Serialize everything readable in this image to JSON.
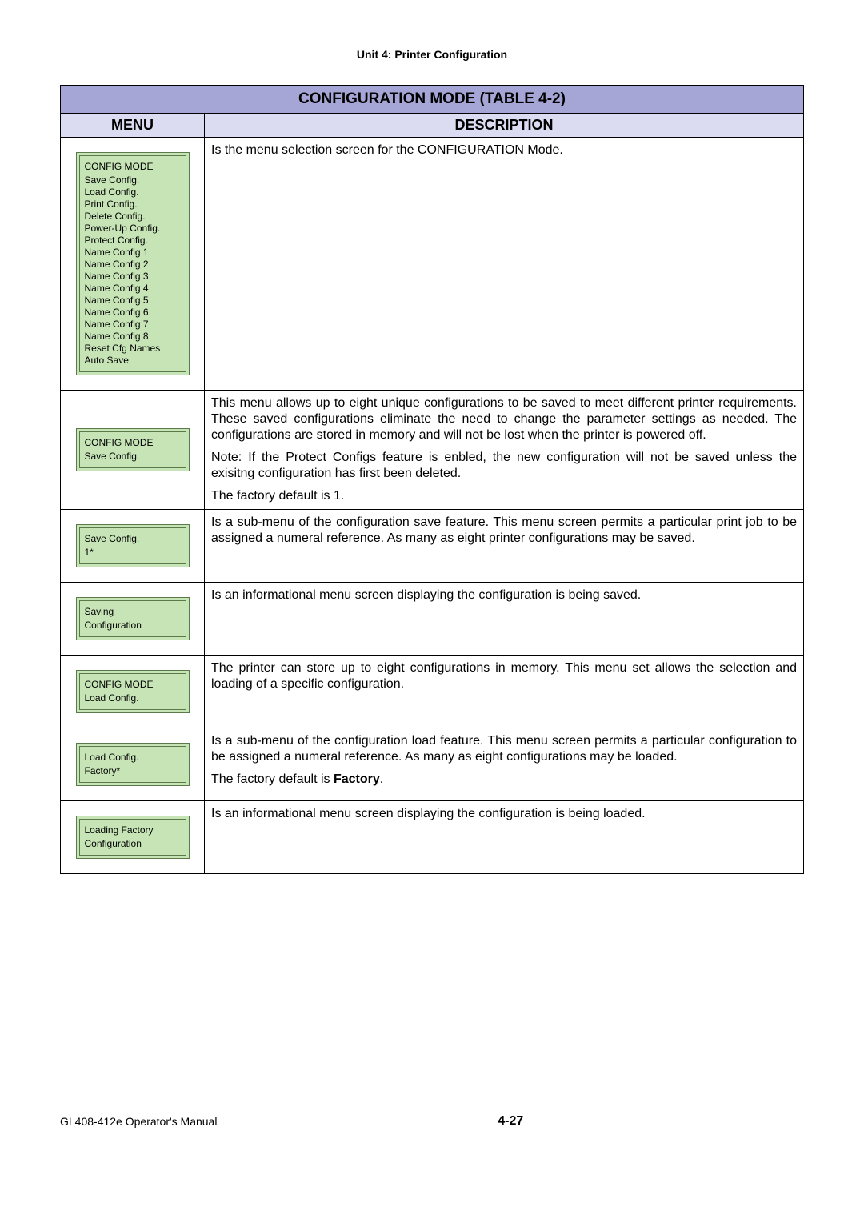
{
  "header": {
    "unit": "Unit 4:  Printer Configuration"
  },
  "table": {
    "title": "CONFIGURATION MODE (TABLE 4-2)",
    "col_menu": "MENU",
    "col_desc": "DESCRIPTION",
    "rows": [
      {
        "lcd": {
          "title": "CONFIG MODE",
          "lines": [
            "Save Config.",
            "Load Config.",
            "Print Config.",
            "Delete Config.",
            "Power-Up Config.",
            "Protect Config.",
            "Name Config 1",
            "Name Config 2",
            "Name Config 3",
            "Name Config 4",
            "Name Config 5",
            "Name Config 6",
            "Name Config 7",
            "Name Config 8",
            "Reset Cfg Names",
            "Auto Save"
          ]
        },
        "desc": [
          "Is the menu selection screen for the CONFIGURATION Mode."
        ]
      },
      {
        "lcd": {
          "title": "CONFIG MODE",
          "lines": [
            "Save Config."
          ]
        },
        "desc": [
          "This menu allows up to eight unique configurations to be saved to meet different printer requirements. These saved configurations eliminate the need to change the parameter settings as needed. The configurations are stored in memory and will not be lost when the printer is powered off.",
          "Note: If the Protect Configs feature is enbled, the new configuration will not be saved unless the exisitng configuration has first been deleted.",
          "The factory default is 1."
        ]
      },
      {
        "lcd": {
          "title": "Save Config.",
          "lines": [
            "1*"
          ]
        },
        "desc": [
          "Is a sub-menu of the configuration save feature. This menu screen permits a particular print job to be assigned a numeral reference. As many as eight printer configurations may be saved."
        ]
      },
      {
        "lcd": {
          "title": "Saving",
          "lines": [
            "Configuration"
          ]
        },
        "desc": [
          "Is an informational menu screen displaying the configuration is being saved."
        ]
      },
      {
        "lcd": {
          "title": "CONFIG MODE",
          "lines": [
            "Load Config."
          ]
        },
        "desc": [
          "The printer can store up to eight configurations in memory. This menu set allows the selection and loading of a specific configuration."
        ]
      },
      {
        "lcd": {
          "title": "Load Config.",
          "lines": [
            "Factory*"
          ]
        },
        "desc": [
          "Is a sub-menu of the configuration load feature. This menu screen permits a particular configuration to be assigned a numeral reference. As many as eight configurations may be loaded.",
          "The factory default is <b>Factory</b>."
        ],
        "desc_html": true
      },
      {
        "lcd": {
          "title": "Loading Factory",
          "lines": [
            "Configuration"
          ]
        },
        "desc": [
          "Is an informational menu screen displaying the configuration is being loaded."
        ]
      }
    ]
  },
  "footer": {
    "left": "GL408-412e Operator's Manual",
    "center": "4-27",
    "right": ""
  }
}
